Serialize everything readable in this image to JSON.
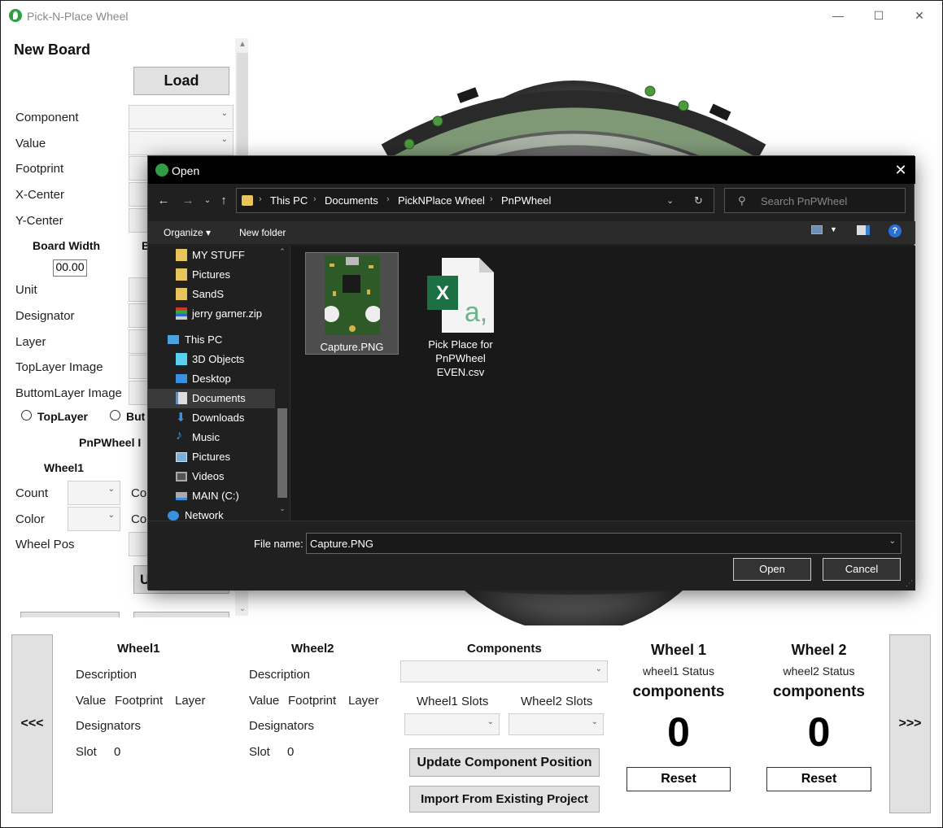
{
  "window": {
    "title": "Pick-N-Place Wheel"
  },
  "left_panel": {
    "title": "New Board",
    "load_label": "Load",
    "fields": [
      "Component",
      "Value",
      "Footprint",
      "X-Center",
      "Y-Center"
    ],
    "board_width_label": "Board Width",
    "board_height_label_partial": "B",
    "board_width_value": "00.00",
    "fields2": [
      "Unit",
      "Designator",
      "Layer",
      "TopLayer Image",
      "ButtomLayer Image"
    ],
    "radio_top": "TopLayer",
    "radio_bottom_partial": "But",
    "pnp_heading_partial": "PnPWheel I",
    "wheel1_heading": "Wheel1",
    "count_label": "Count",
    "color_label": "Color",
    "wheelpos_label": "Wheel Pos",
    "co_partial": "Co",
    "update_partial": "U"
  },
  "dialog": {
    "title": "Open",
    "breadcrumbs": [
      "This PC",
      "Documents",
      "PickNPlace Wheel",
      "PnPWheel"
    ],
    "search_placeholder": "Search PnPWheel",
    "organize_label": "Organize ▾",
    "new_folder_label": "New folder",
    "nav_items": [
      {
        "label": "MY STUFF",
        "icon": "folder-icon"
      },
      {
        "label": "Pictures",
        "icon": "folder-icon"
      },
      {
        "label": "SandS",
        "icon": "folder-icon"
      },
      {
        "label": "jerry garner.zip",
        "icon": "zip-icon"
      },
      {
        "label": "This PC",
        "icon": "computer-icon"
      },
      {
        "label": "3D Objects",
        "icon": "cube-icon"
      },
      {
        "label": "Desktop",
        "icon": "desktop-icon"
      },
      {
        "label": "Documents",
        "icon": "documents-icon"
      },
      {
        "label": "Downloads",
        "icon": "download-icon"
      },
      {
        "label": "Music",
        "icon": "music-icon"
      },
      {
        "label": "Pictures",
        "icon": "pictures-icon"
      },
      {
        "label": "Videos",
        "icon": "video-icon"
      },
      {
        "label": "MAIN (C:)",
        "icon": "drive-icon"
      },
      {
        "label": "Network",
        "icon": "network-icon"
      }
    ],
    "files": [
      {
        "name": "Capture.PNG"
      },
      {
        "name_lines": [
          "Pick Place for",
          "PnPWheel",
          "EVEN.csv"
        ]
      }
    ],
    "filename_label": "File name:",
    "filename_value": "Capture.PNG",
    "open_label": "Open",
    "cancel_label": "Cancel"
  },
  "bottom": {
    "prev_label": "<<<",
    "next_label": ">>>",
    "wheel1": {
      "heading": "Wheel1",
      "description": "Description",
      "value": "Value",
      "footprint": "Footprint",
      "layer": "Layer",
      "designators": "Designators",
      "slot": "Slot",
      "slot_value": "0"
    },
    "wheel2": {
      "heading": "Wheel2",
      "description": "Description",
      "value": "Value",
      "footprint": "Footprint",
      "layer": "Layer",
      "designators": "Designators",
      "slot": "Slot",
      "slot_value": "0"
    },
    "components": {
      "heading": "Components",
      "wheel1_slots": "Wheel1 Slots",
      "wheel2_slots": "Wheel2 Slots",
      "update_label": "Update Component Position",
      "import_label": "Import From Existing Project"
    },
    "status1": {
      "heading": "Wheel 1",
      "status": "wheel1 Status",
      "components": "components",
      "count": "0",
      "reset": "Reset"
    },
    "status2": {
      "heading": "Wheel 2",
      "status": "wheel2 Status",
      "components": "components",
      "count": "0",
      "reset": "Reset"
    }
  }
}
